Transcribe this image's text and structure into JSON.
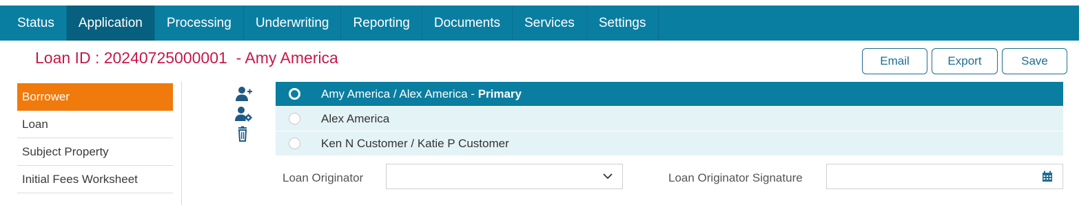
{
  "nav": {
    "tabs": [
      {
        "label": "Status"
      },
      {
        "label": "Application"
      },
      {
        "label": "Processing"
      },
      {
        "label": "Underwriting"
      },
      {
        "label": "Reporting"
      },
      {
        "label": "Documents"
      },
      {
        "label": "Services"
      },
      {
        "label": "Settings"
      }
    ],
    "active": "Application"
  },
  "header": {
    "loan_title": "Loan ID : 20240725000001  - Amy America"
  },
  "actions": {
    "email_label": "Email",
    "export_label": "Export",
    "save_label": "Save"
  },
  "sidebar": {
    "items": [
      {
        "label": "Borrower"
      },
      {
        "label": "Loan"
      },
      {
        "label": "Subject Property"
      },
      {
        "label": "Initial Fees Worksheet"
      }
    ],
    "active": "Borrower"
  },
  "borrowers": {
    "rows": [
      {
        "name": "Amy America / Alex America",
        "suffix": " - ",
        "tag": "Primary",
        "selected": true
      },
      {
        "name": "Alex America",
        "selected": false
      },
      {
        "name": "Ken N Customer / Katie P Customer",
        "selected": false
      }
    ],
    "icons": [
      "add-user-icon",
      "user-settings-icon",
      "trash-icon"
    ]
  },
  "fields": {
    "loan_originator_label": "Loan Originator",
    "loan_originator_value": "",
    "loan_originator_signature_label": "Loan Originator Signature",
    "loan_originator_signature_value": ""
  },
  "colors": {
    "nav_bg": "#0a7ea0",
    "nav_active": "#07607f",
    "title": "#c8174a",
    "sidebar_active": "#f07a0c",
    "row_bg": "#e3f3f6"
  }
}
